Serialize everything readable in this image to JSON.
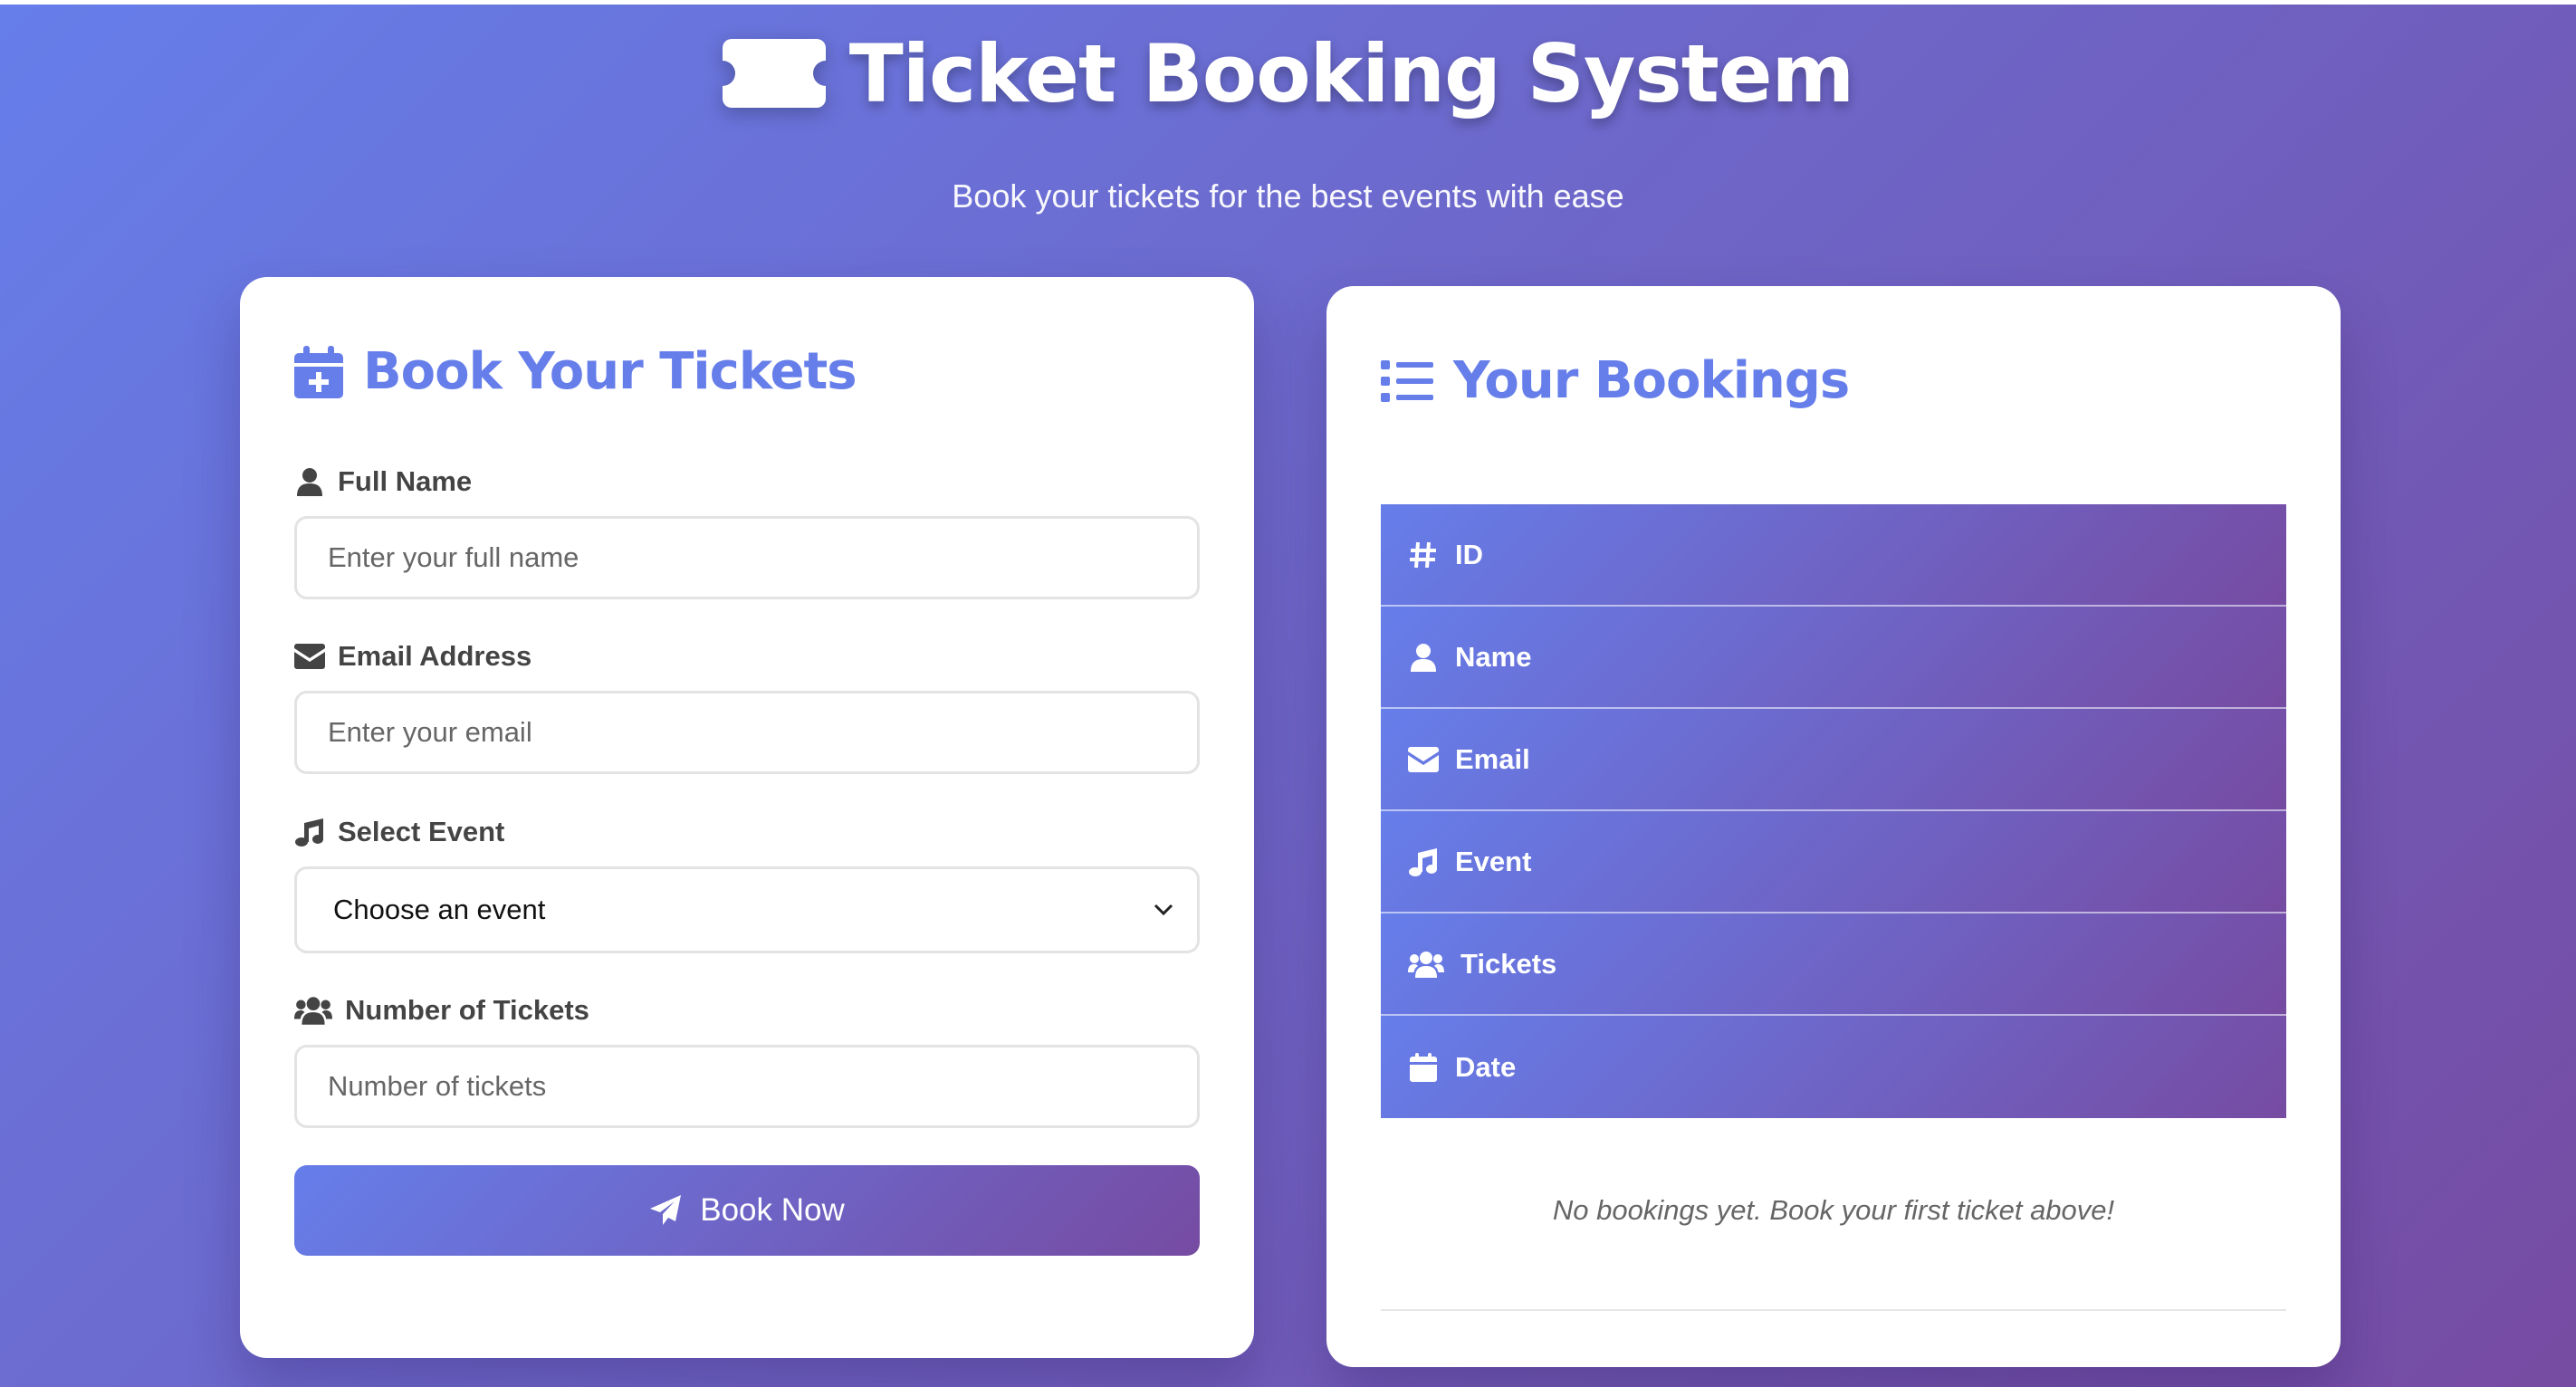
{
  "header": {
    "title": "Ticket Booking System",
    "subtitle": "Book your tickets for the best events with ease"
  },
  "form": {
    "title": "Book Your Tickets",
    "full_name": {
      "label": "Full Name",
      "placeholder": "Enter your full name",
      "value": ""
    },
    "email": {
      "label": "Email Address",
      "placeholder": "Enter your email",
      "value": ""
    },
    "event": {
      "label": "Select Event",
      "selected": "Choose an event"
    },
    "tickets": {
      "label": "Number of Tickets",
      "placeholder": "Number of tickets",
      "value": ""
    },
    "submit_label": "Book Now"
  },
  "bookings": {
    "title": "Your Bookings",
    "columns": [
      {
        "label": "ID",
        "icon": "hash-icon"
      },
      {
        "label": "Name",
        "icon": "user-icon"
      },
      {
        "label": "Email",
        "icon": "envelope-icon"
      },
      {
        "label": "Event",
        "icon": "music-icon"
      },
      {
        "label": "Tickets",
        "icon": "users-icon"
      },
      {
        "label": "Date",
        "icon": "calendar-icon"
      }
    ],
    "empty_message": "No bookings yet. Book your first ticket above!"
  },
  "colors": {
    "accent": "#667eea",
    "gradient_start": "#667eea",
    "gradient_end": "#764ba2",
    "label_text": "#444444"
  }
}
